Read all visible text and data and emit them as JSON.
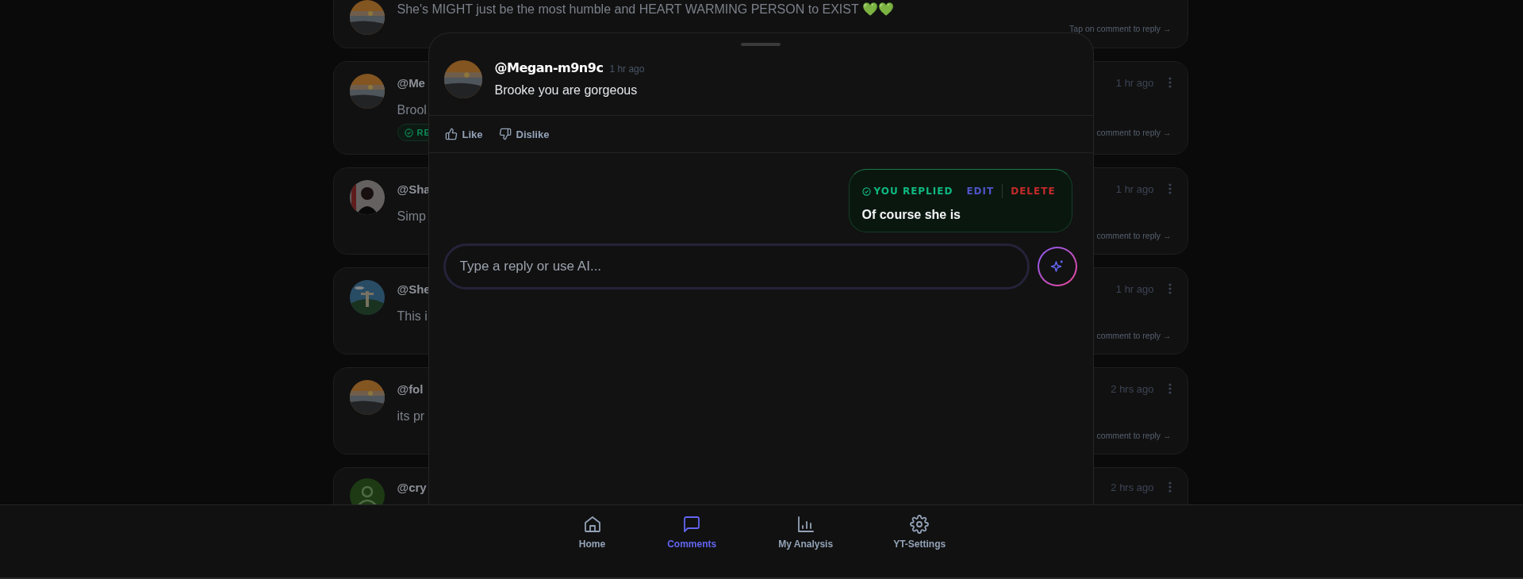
{
  "comments": [
    {
      "text": "She's MIGHT just be the most humble and HEART WARMING PERSON to EXIST 💚💚",
      "hint": "Tap on comment to reply →"
    },
    {
      "author": "@Me",
      "text": "Brool",
      "badge": "RE",
      "time": "1 hr ago",
      "hint": "comment to reply →"
    },
    {
      "author": "@Sha",
      "text": "Simp",
      "time": "1 hr ago",
      "hint": "comment to reply →"
    },
    {
      "author": "@She",
      "text": "This i",
      "time": "1 hr ago",
      "hint": "comment to reply →"
    },
    {
      "author": "@fol",
      "text": "its pr",
      "time": "2 hrs ago",
      "hint": "comment to reply →"
    },
    {
      "avatar": {
        "kind": "silhouette"
      },
      "author": "@cry",
      "time": "2 hrs ago"
    }
  ],
  "reply_sheet": {
    "author": "@Megan-m9n9c",
    "time": "1 hr ago",
    "text": "Brooke you are gorgeous",
    "actions": [
      {
        "label": "Like",
        "kind": "like"
      },
      {
        "label": "Dislike",
        "kind": "dislike"
      }
    ],
    "my_reply": {
      "status": "YOU REPLIED",
      "edit": "EDIT",
      "delete": "DELETE",
      "text": "Of course she is"
    },
    "input": {
      "placeholder": "Type a reply or use AI..."
    }
  },
  "nav": [
    {
      "label": "Home",
      "kind": "home",
      "selected": false
    },
    {
      "label": "Comments",
      "kind": "comments",
      "selected": true
    },
    {
      "label": "My Analysis",
      "kind": "analysis",
      "selected": false
    },
    {
      "label": "YT-Settings",
      "kind": "settings",
      "selected": false
    }
  ]
}
